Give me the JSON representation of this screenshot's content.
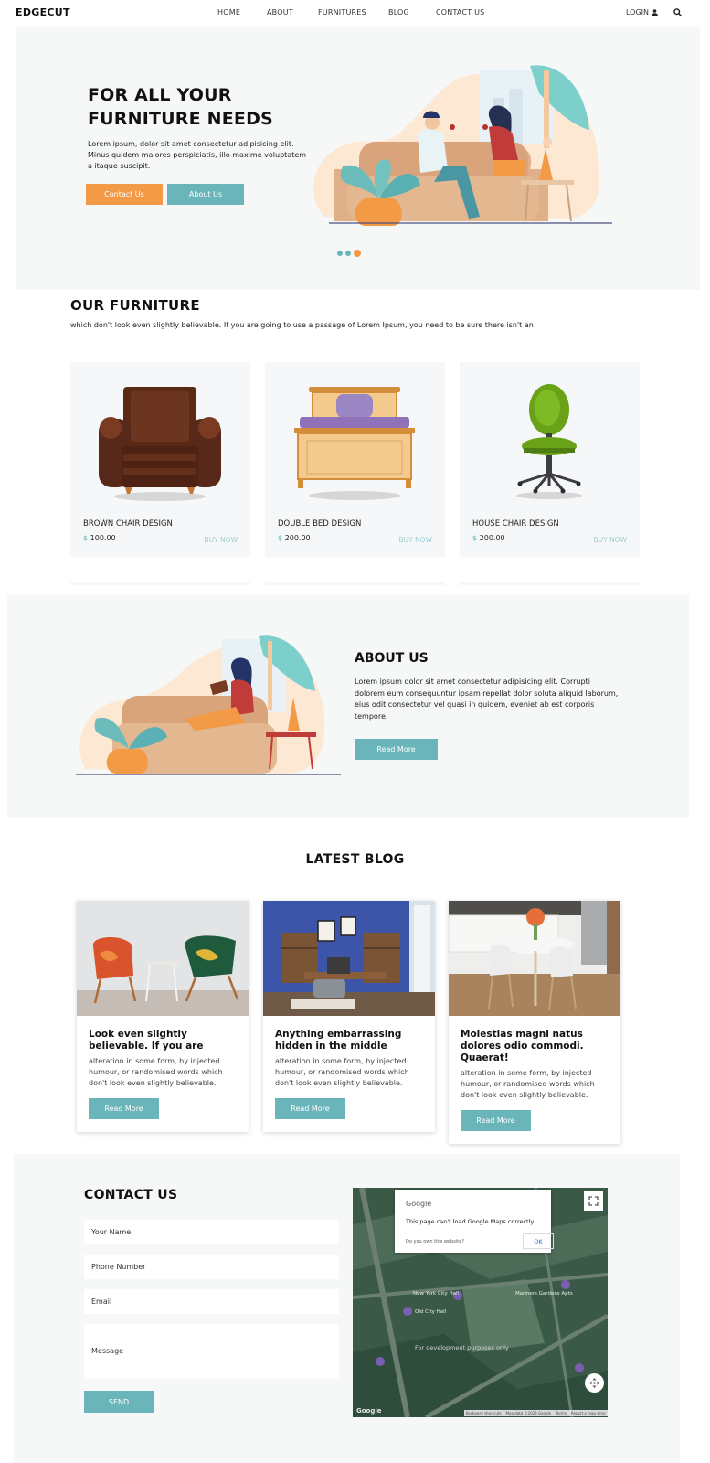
{
  "nav": {
    "logo": "EDGECUT",
    "links": [
      "HOME",
      "ABOUT",
      "FURNITURES",
      "BLOG",
      "CONTACT US"
    ],
    "login": "LOGIN"
  },
  "hero": {
    "title_line1": "FOR ALL YOUR",
    "title_line2": "FURNITURE NEEDS",
    "text": "Lorem ipsum, dolor sit amet consectetur adipisicing elit. Minus quidem maiores perspiciatis, illo maxime voluptatem a itaque suscipit.",
    "btn_contact": "Contact Us",
    "btn_about": "About Us",
    "slides": 3,
    "active_slide": 3
  },
  "furniture": {
    "title": "OUR FURNITURE",
    "subtitle": "which don't look even slightly believable. If you are going to use a passage of Lorem Ipsum, you need to be sure there isn't an",
    "items": [
      {
        "name": "BROWN CHAIR DESIGN",
        "currency": "$",
        "price": "100.00",
        "action": "BUY NOW"
      },
      {
        "name": "DOUBLE BED DESIGN",
        "currency": "$",
        "price": "200.00",
        "action": "BUY NOW"
      },
      {
        "name": "HOUSE CHAIR DESIGN",
        "currency": "$",
        "price": "200.00",
        "action": "BUY NOW"
      }
    ]
  },
  "about": {
    "title": "ABOUT US",
    "text": "Lorem ipsum dolor sit amet consectetur adipisicing elit. Corrupti dolorem eum consequuntur ipsam repellat dolor soluta aliquid laborum, eius odit consectetur vel quasi in quidem, eveniet ab est corporis tempore.",
    "btn": "Read More"
  },
  "blog": {
    "title": "LATEST BLOG",
    "posts": [
      {
        "title": "Look even slightly believable. If you are",
        "text": "alteration in some form, by injected humour, or randomised words which don't look even slightly believable.",
        "btn": "Read More"
      },
      {
        "title": "Anything embarrassing hidden in the middle",
        "text": "alteration in some form, by injected humour, or randomised words which don't look even slightly believable.",
        "btn": "Read More"
      },
      {
        "title": "Molestias magni natus dolores odio commodi. Quaerat!",
        "text": "alteration in some form, by injected humour, or randomised words which don't look even slightly believable.",
        "btn": "Read More"
      }
    ]
  },
  "contact": {
    "title": "CONTACT US",
    "name_placeholder": "Your Name",
    "phone_placeholder": "Phone Number",
    "email_placeholder": "Email",
    "message_placeholder": "Message",
    "send": "SEND"
  },
  "map": {
    "dialog_brand": "Google",
    "dialog_message": "This page can't load Google Maps correctly.",
    "dialog_question": "Do you own this website?",
    "dialog_ok": "OK",
    "dev_text": "For development purposes only",
    "place1": "New York City Hall",
    "place2": "Old City Hall",
    "place3": "Mariners Gardens Apts",
    "logo": "Google",
    "footer": [
      "Keyboard shortcuts",
      "Map data ©2023 Google",
      "Terms",
      "Report a map error"
    ]
  },
  "colors": {
    "accent_orange": "#f39a47",
    "accent_teal": "#6ab5ba",
    "section_bg": "#f6f8f8"
  }
}
